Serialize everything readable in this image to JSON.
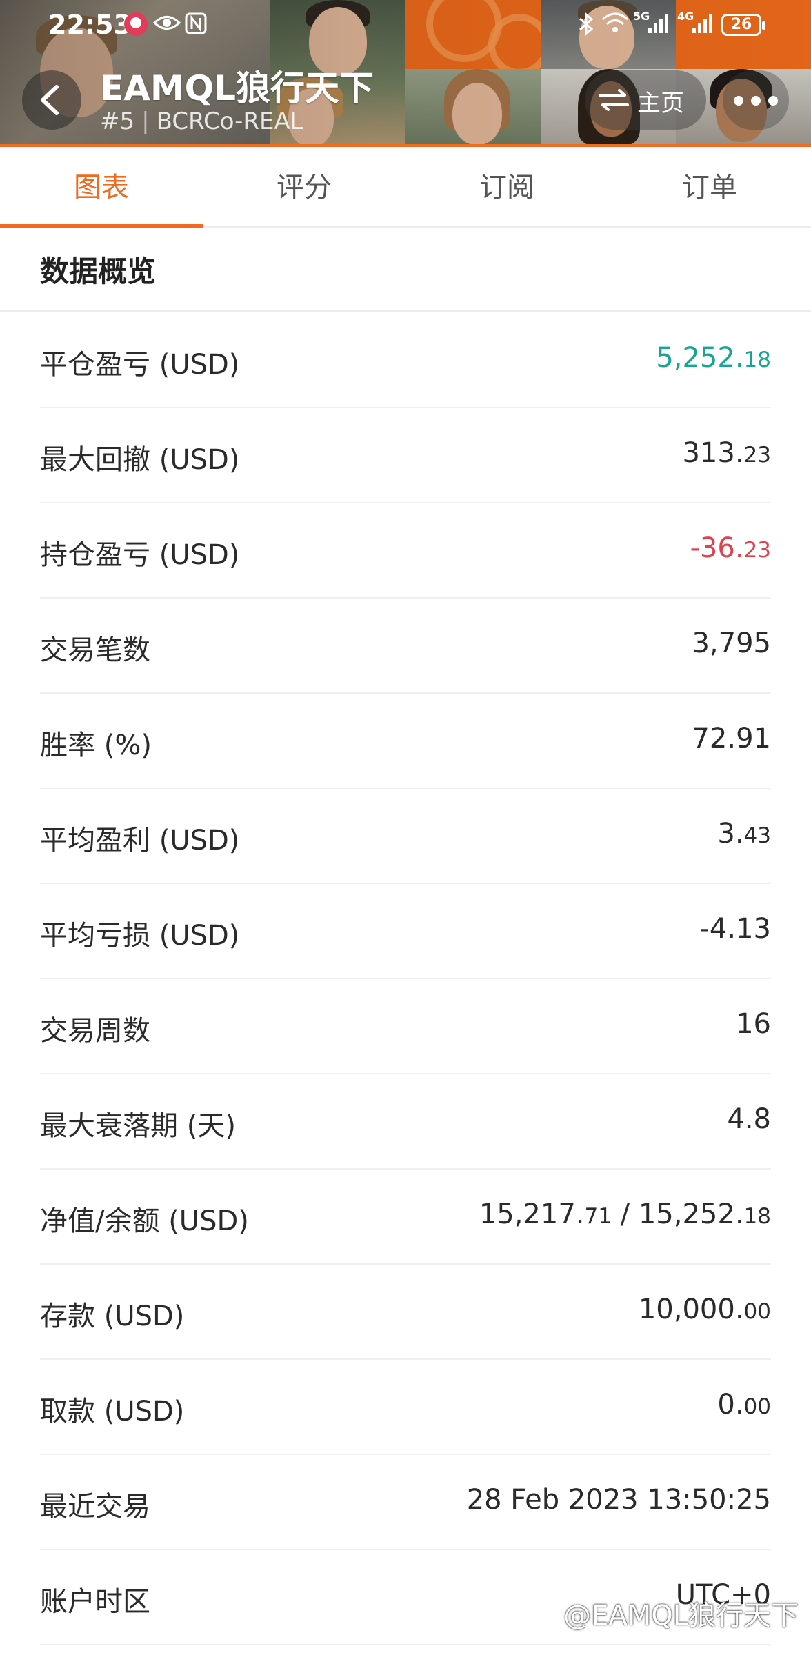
{
  "status_bar": {
    "time": "22:53",
    "battery": "26",
    "network_5g": "5G",
    "network_4g": "4G"
  },
  "header": {
    "title": "EAMQL狼行天下",
    "rank": "#5",
    "server": "BCRCo-REAL",
    "home_label": "主页"
  },
  "tabs": [
    {
      "label": "图表",
      "active": true
    },
    {
      "label": "评分",
      "active": false
    },
    {
      "label": "订阅",
      "active": false
    },
    {
      "label": "订单",
      "active": false
    }
  ],
  "section": {
    "title": "数据概览"
  },
  "rows": [
    {
      "label": "平仓盈亏 (USD)",
      "value_main": "5,252.",
      "value_decimal": "18",
      "color": "#16a58f"
    },
    {
      "label": "最大回撤 (USD)",
      "value_main": "313.",
      "value_decimal": "23",
      "color": "#2a2a2a"
    },
    {
      "label": "持仓盈亏 (USD)",
      "value_main": "-36.",
      "value_decimal": "23",
      "color": "#e0414f"
    },
    {
      "label": "交易笔数",
      "value_main": "3,795",
      "value_decimal": "",
      "color": "#2a2a2a"
    },
    {
      "label": "胜率 (%)",
      "value_main": "72.91",
      "value_decimal": "",
      "color": "#2a2a2a"
    },
    {
      "label": "平均盈利 (USD)",
      "value_main": "3.",
      "value_decimal": "43",
      "color": "#2a2a2a"
    },
    {
      "label": "平均亏损 (USD)",
      "value_main": "-4.13",
      "value_decimal": "",
      "color": "#2a2a2a"
    },
    {
      "label": "交易周数",
      "value_main": "16",
      "value_decimal": "",
      "color": "#2a2a2a"
    },
    {
      "label": "最大衰落期 (天)",
      "value_main": "4.8",
      "value_decimal": "",
      "color": "#2a2a2a"
    },
    {
      "label": "净值/余额 (USD)",
      "value_main": "15,217.",
      "value_decimal": "71",
      "value_main2": " / 15,252.",
      "value_decimal2": "18",
      "color": "#2a2a2a"
    },
    {
      "label": "存款 (USD)",
      "value_main": "10,000.",
      "value_decimal": "00",
      "color": "#2a2a2a"
    },
    {
      "label": "取款 (USD)",
      "value_main": "0.",
      "value_decimal": "00",
      "color": "#2a2a2a"
    },
    {
      "label": "最近交易",
      "value_main": "28 Feb 2023 13:50:25",
      "value_decimal": "",
      "color": "#2a2a2a"
    },
    {
      "label": "账户时区",
      "value_main": "UTC+0",
      "value_decimal": "",
      "color": "#2a2a2a"
    }
  ],
  "watermark": "@EAMQL狼行天下",
  "colors": {
    "accent": "#f06a22",
    "profit": "#16a58f",
    "loss": "#e0414f"
  }
}
